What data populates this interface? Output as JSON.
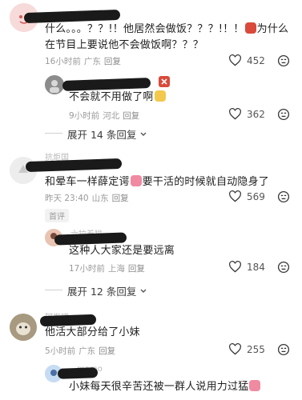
{
  "comments": [
    {
      "text_part1": "什么。。。？？!！他居然会做饭？？？!！！",
      "text_part2": "为什么在节目上要说他不会做饭啊？？？",
      "meta_time": "16小时前",
      "meta_loc": "广东",
      "reply_label": "回复",
      "likes": "452"
    },
    {
      "text": "不会就不用做了啊",
      "meta_time": "9小时前",
      "meta_loc": "河北",
      "reply_label": "回复",
      "likes": "362"
    },
    {
      "expand_label": "展开 14 条回复"
    },
    {
      "name_faint": "抗炬国",
      "text_part1": "和晕车一样薛定谔",
      "text_part2": "要干活的时候就自动隐身了",
      "meta_time": "昨天 23:40",
      "meta_loc": "山东",
      "reply_label": "回复",
      "likes": "569",
      "tag": "首评"
    },
    {
      "name_faint": "六拉着猫",
      "text": "这种人大家还是要远离",
      "meta_time": "17小时前",
      "meta_loc": "上海",
      "reply_label": "回复",
      "likes": "184"
    },
    {
      "expand_label": "展开 12 条回复"
    },
    {
      "name_faint": "阿发喵",
      "text": "他活大部分给了小妹",
      "meta_time": "5小时前",
      "meta_loc": "广东",
      "reply_label": "回复",
      "likes": "255"
    },
    {
      "name_faint": "momo",
      "text": "小妹每天很辛苦还被一群人说用力过猛"
    }
  ],
  "colors": {
    "text": "#1f1f1f",
    "meta": "#9a9a9a",
    "emoji_red": "#d94a3a",
    "emoji_pink": "#f08aa0",
    "emoji_yellow": "#f2c94c"
  }
}
